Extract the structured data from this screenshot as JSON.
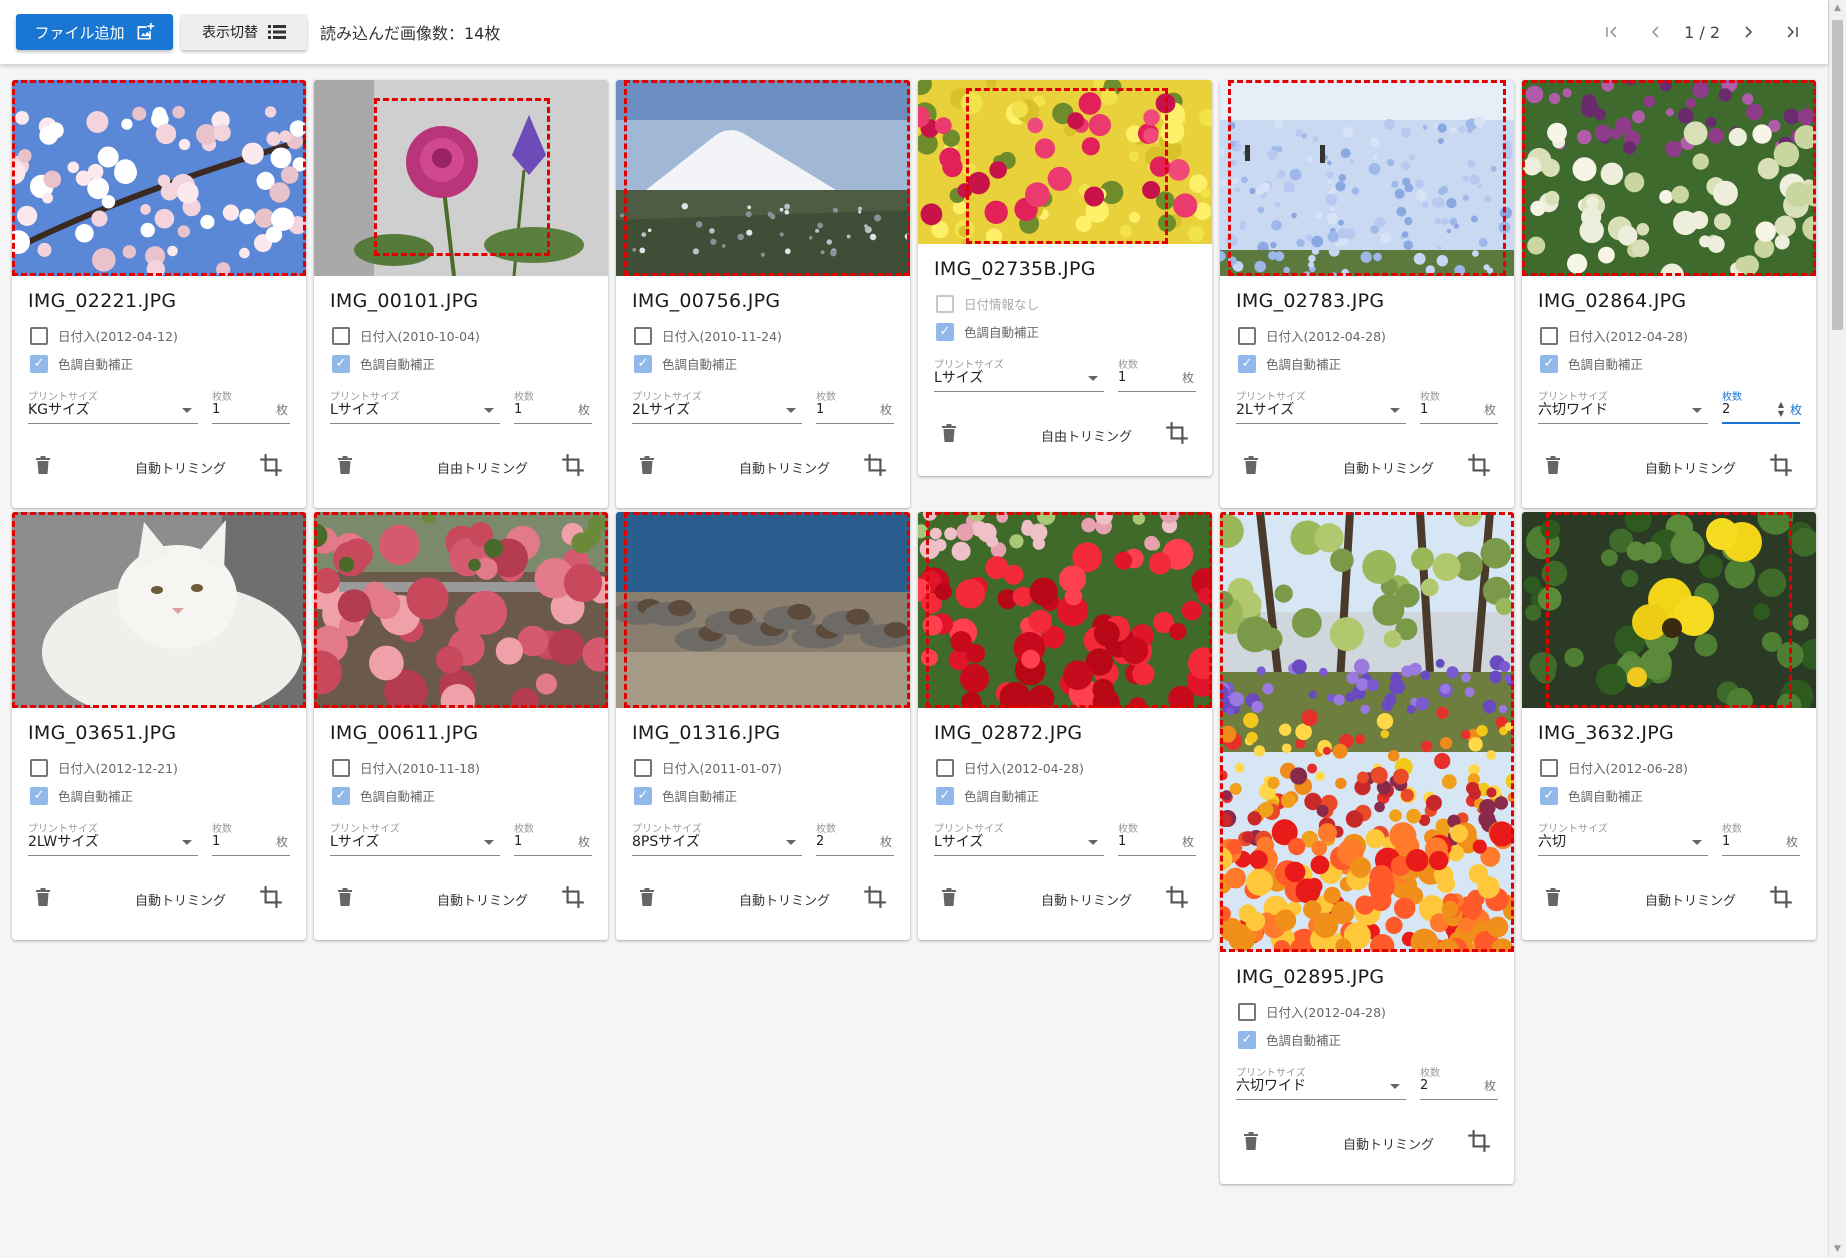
{
  "toolbar": {
    "add_file_label": "ファイル追加",
    "toggle_view_label": "表示切替",
    "image_count_text": "読み込んだ画像数：14枚",
    "page_indicator": "1 / 2"
  },
  "card_labels": {
    "date_prefix": "日付入",
    "no_date": "日付情報なし",
    "color_correction": "色調自動補正",
    "print_size": "プリントサイズ",
    "quantity": "枚数",
    "quantity_unit": "枚",
    "auto_trim": "自動トリミング",
    "free_trim": "自由トリミング"
  },
  "cards": [
    {
      "filename": "IMG_02221.JPG",
      "date_text": "日付入(2012-04-12)",
      "date_checked": false,
      "color_correction_checked": true,
      "print_size": "KGサイズ",
      "quantity": "1",
      "trim_label": "自動トリミング"
    },
    {
      "filename": "IMG_00101.JPG",
      "date_text": "日付入(2010-10-04)",
      "date_checked": false,
      "color_correction_checked": true,
      "print_size": "Lサイズ",
      "quantity": "1",
      "trim_label": "自由トリミング"
    },
    {
      "filename": "IMG_00756.JPG",
      "date_text": "日付入(2010-11-24)",
      "date_checked": false,
      "color_correction_checked": true,
      "print_size": "2Lサイズ",
      "quantity": "1",
      "trim_label": "自動トリミング"
    },
    {
      "filename": "IMG_02735B.JPG",
      "date_text": "日付情報なし",
      "date_checked": false,
      "date_disabled": true,
      "color_correction_checked": true,
      "print_size": "Lサイズ",
      "quantity": "1",
      "trim_label": "自由トリミング"
    },
    {
      "filename": "IMG_02783.JPG",
      "date_text": "日付入(2012-04-28)",
      "date_checked": false,
      "color_correction_checked": true,
      "print_size": "2Lサイズ",
      "quantity": "1",
      "trim_label": "自動トリミング"
    },
    {
      "filename": "IMG_02864.JPG",
      "date_text": "日付入(2012-04-28)",
      "date_checked": false,
      "color_correction_checked": true,
      "print_size": "六切ワイド",
      "quantity": "2",
      "trim_label": "自動トリミング",
      "quantity_focused": true
    },
    {
      "filename": "IMG_03651.JPG",
      "date_text": "日付入(2012-12-21)",
      "date_checked": false,
      "color_correction_checked": true,
      "print_size": "2LWサイズ",
      "quantity": "1",
      "trim_label": "自動トリミング"
    },
    {
      "filename": "IMG_00611.JPG",
      "date_text": "日付入(2010-11-18)",
      "date_checked": false,
      "color_correction_checked": true,
      "print_size": "Lサイズ",
      "quantity": "1",
      "trim_label": "自動トリミング"
    },
    {
      "filename": "IMG_01316.JPG",
      "date_text": "日付入(2011-01-07)",
      "date_checked": false,
      "color_correction_checked": true,
      "print_size": "8PSサイズ",
      "quantity": "2",
      "trim_label": "自動トリミング"
    },
    {
      "filename": "IMG_02872.JPG",
      "date_text": "日付入(2012-04-28)",
      "date_checked": false,
      "color_correction_checked": true,
      "print_size": "Lサイズ",
      "quantity": "1",
      "trim_label": "自動トリミング"
    },
    {
      "filename": "IMG_02895.JPG",
      "date_text": "日付入(2012-04-28)",
      "date_checked": false,
      "color_correction_checked": true,
      "print_size": "六切ワイド",
      "quantity": "2",
      "trim_label": "自動トリミング"
    },
    {
      "filename": "IMG_3632.JPG",
      "date_text": "日付入(2012-06-28)",
      "date_checked": false,
      "color_correction_checked": true,
      "print_size": "六切",
      "quantity": "1",
      "trim_label": "自動トリミング"
    }
  ],
  "colors": {
    "primary": "#1976d2",
    "trim_border": "#e00000",
    "checkbox_checked": "#90b9ea"
  }
}
